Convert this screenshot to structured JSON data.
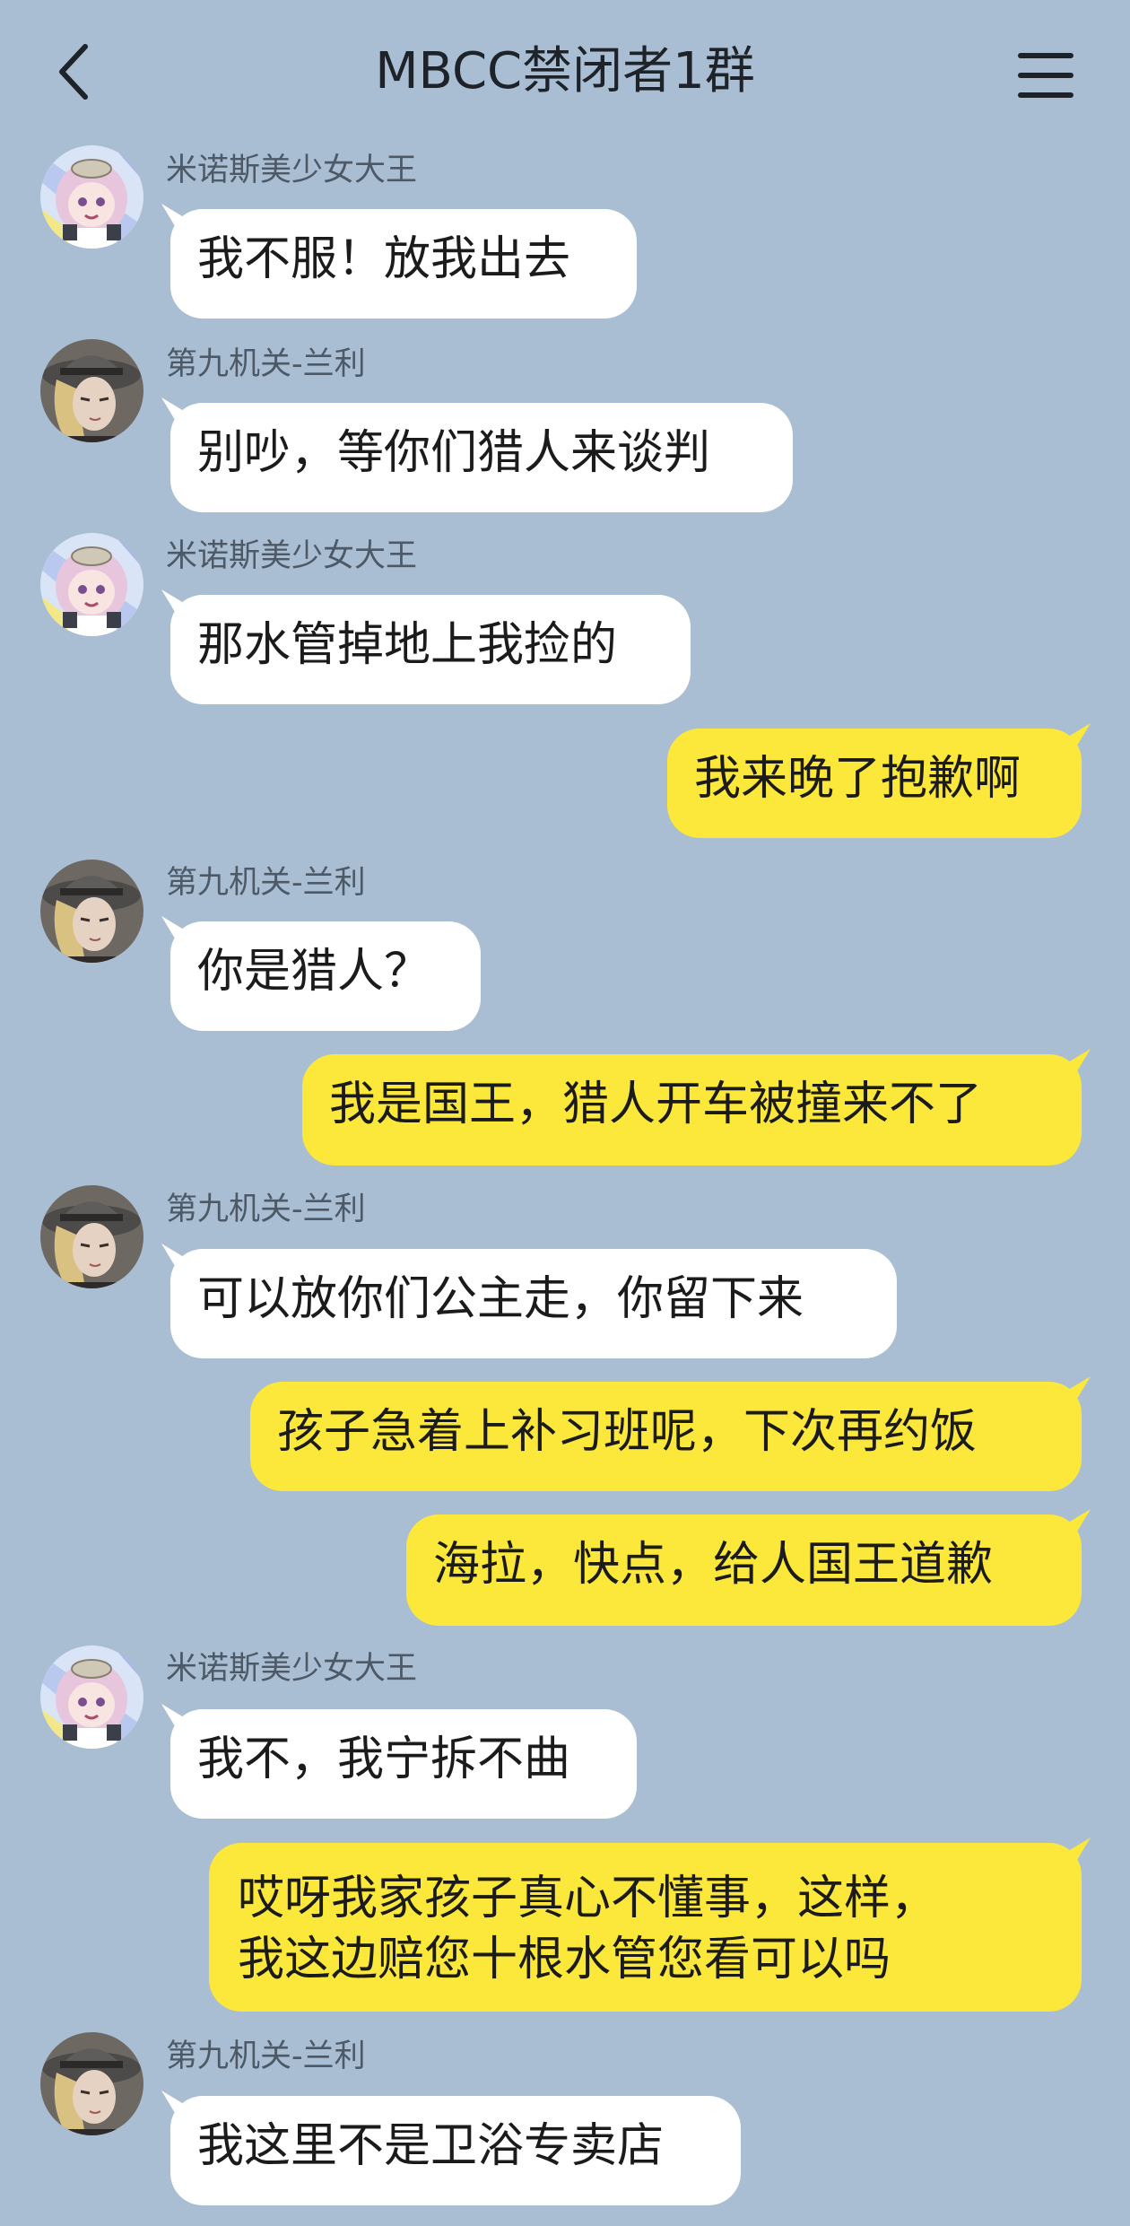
{
  "header": {
    "title": "MBCC禁闭者1群",
    "back_icon": "chevron-left-icon",
    "menu_icon": "hamburger-menu-icon"
  },
  "colors": {
    "background": "#a9bed2",
    "incoming_bubble": "#ffffff",
    "outgoing_bubble": "#fbe83a"
  },
  "messages": [
    {
      "side": "left",
      "sender": "米诺斯美少女大王",
      "avatar": "pink-haired-girl-avatar",
      "text": "我不服！放我出去"
    },
    {
      "side": "left",
      "sender": "第九机关-兰利",
      "avatar": "gray-hat-man-avatar",
      "text": "别吵，等你们猎人来谈判"
    },
    {
      "side": "left",
      "sender": "米诺斯美少女大王",
      "avatar": "pink-haired-girl-avatar",
      "text": "那水管掉地上我捡的"
    },
    {
      "side": "right",
      "text": "我来晚了抱歉啊"
    },
    {
      "side": "left",
      "sender": "第九机关-兰利",
      "avatar": "gray-hat-man-avatar",
      "text": "你是猎人？"
    },
    {
      "side": "right",
      "text": "我是国王，猎人开车被撞来不了"
    },
    {
      "side": "left",
      "sender": "第九机关-兰利",
      "avatar": "gray-hat-man-avatar",
      "text": "可以放你们公主走，你留下来"
    },
    {
      "side": "right",
      "text": "孩子急着上补习班呢，下次再约饭"
    },
    {
      "side": "right",
      "text": "海拉，快点，给人国王道歉"
    },
    {
      "side": "left",
      "sender": "米诺斯美少女大王",
      "avatar": "pink-haired-girl-avatar",
      "text": "我不，我宁拆不曲"
    },
    {
      "side": "right",
      "lines": [
        "哎呀我家孩子真心不懂事，这样，",
        "我这边赔您十根水管您看可以吗"
      ]
    },
    {
      "side": "left",
      "sender": "第九机关-兰利",
      "avatar": "gray-hat-man-avatar",
      "text": "我这里不是卫浴专卖店"
    }
  ]
}
